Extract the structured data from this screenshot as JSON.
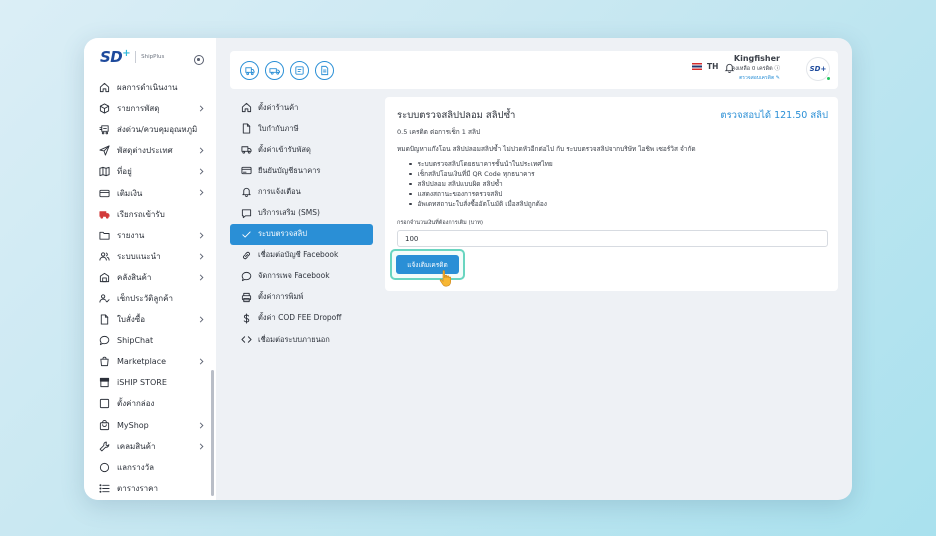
{
  "logo": {
    "brand": "SD",
    "plus": "+",
    "product": "ShipPlus"
  },
  "sidebar": {
    "items": [
      {
        "label": "ผลการดำเนินงาน",
        "icon": "home-icon",
        "chevron": false
      },
      {
        "label": "รายการพัสดุ",
        "icon": "box-icon",
        "chevron": true
      },
      {
        "label": "ส่งด่วน/ควบคุมอุณหภูมิ",
        "icon": "fast-delivery-icon",
        "chevron": false
      },
      {
        "label": "พัสดุต่างประเทศ",
        "icon": "send-icon",
        "chevron": true
      },
      {
        "label": "ที่อยู่",
        "icon": "map-icon",
        "chevron": true
      },
      {
        "label": "เติมเงิน",
        "icon": "wallet-icon",
        "chevron": true
      },
      {
        "label": "เรียกรถเข้ารับ",
        "icon": "truck-icon",
        "chevron": false
      },
      {
        "label": "รายงาน",
        "icon": "folder-icon",
        "chevron": true
      },
      {
        "label": "ระบบแนะนำ",
        "icon": "users-icon",
        "chevron": true
      },
      {
        "label": "คลังสินค้า",
        "icon": "warehouse-icon",
        "chevron": true
      },
      {
        "label": "เช็กประวัติลูกค้า",
        "icon": "user-check-icon",
        "chevron": false
      },
      {
        "label": "ใบสั่งซื้อ",
        "icon": "document-icon",
        "chevron": true
      },
      {
        "label": "ShipChat",
        "icon": "chat-icon",
        "chevron": false
      },
      {
        "label": "Marketplace",
        "icon": "store-bag-icon",
        "chevron": true
      },
      {
        "label": "iSHIP STORE",
        "icon": "shop-icon",
        "chevron": false
      },
      {
        "label": "ตั้งค่ากล่อง",
        "icon": "square-box-icon",
        "chevron": false
      },
      {
        "label": "MyShop",
        "icon": "shopping-bag-icon",
        "chevron": true
      },
      {
        "label": "เคลมสินค้า",
        "icon": "wrench-icon",
        "chevron": true
      },
      {
        "label": "แลกรางวัล",
        "icon": "circle-icon",
        "chevron": false
      },
      {
        "label": "ตารางราคา",
        "icon": "list-icon",
        "chevron": false
      }
    ]
  },
  "topbar": {
    "language": "TH",
    "user_name": "Kingfisher",
    "credit_text": "คงเหลือ 0 เครดิต",
    "credit_link": "ตรวจสอบเครดิต",
    "avatar_text": "SD+"
  },
  "settings_menu": {
    "items": [
      {
        "label": "ตั้งค่าร้านค้า",
        "icon": "home-icon",
        "active": false
      },
      {
        "label": "ใบกำกับภาษี",
        "icon": "document-icon",
        "active": false
      },
      {
        "label": "ตั้งค่าเข้ารับพัสดุ",
        "icon": "truck-icon",
        "active": false
      },
      {
        "label": "ยืนยันบัญชีธนาคาร",
        "icon": "bank-card-icon",
        "active": false
      },
      {
        "label": "การแจ้งเตือน",
        "icon": "bell-icon",
        "active": false
      },
      {
        "label": "บริการเสริม (SMS)",
        "icon": "message-icon",
        "active": false
      },
      {
        "label": "ระบบตรวจสลิป",
        "icon": "check-icon",
        "active": true
      },
      {
        "label": "เชื่อมต่อบัญชี Facebook",
        "icon": "link-icon",
        "active": false
      },
      {
        "label": "จัดการเพจ Facebook",
        "icon": "chat-icon",
        "active": false
      },
      {
        "label": "ตั้งค่าการพิมพ์",
        "icon": "printer-icon",
        "active": false
      },
      {
        "label": "ตั้งค่า COD FEE Dropoff",
        "icon": "dollar-icon",
        "active": false
      },
      {
        "label": "เชื่อมต่อระบบภายนอก",
        "icon": "code-icon",
        "active": false
      }
    ]
  },
  "card": {
    "title": "ระบบตรวจสลิปปลอม สลิปซ้ำ",
    "balance": "ตรวจสอบได้ 121.50 สลิป",
    "subtitle": "0.5 เครดิต ต่อการเช็ก 1 สลิป",
    "description": "หมดปัญหาแก๊งโอน สลิปปลอมสลิปซ้ำ ไม่ปวดหัวอีกต่อไป กับ ระบบตรวจสลิปจากบริษัท ไอชิพ เซอร์วิส จำกัด",
    "features": [
      "ระบบตรวจสลิปโดยธนาคารชั้นนำในประเทศไทย",
      "เช็กสลิปโอนเงินที่มี QR Code ทุกธนาคาร",
      "สลิปปลอม สลิปแบบผิด สลิปซ้ำ",
      "แสดงสถานะของการตรวจสลิป",
      "อัพเดทสถานะใบสั่งซื้ออัตโนมัติ เมื่อสลิปถูกต้อง"
    ],
    "amount_label": "กรอกจำนวนเงินที่ต้องการเติม (บาท)",
    "amount_value": "100",
    "topup_button": "แจ้งเติมเครดิต"
  },
  "colors": {
    "primary": "#2a8fd6",
    "highlight": "#69d5c0",
    "text": "#2c313a"
  }
}
